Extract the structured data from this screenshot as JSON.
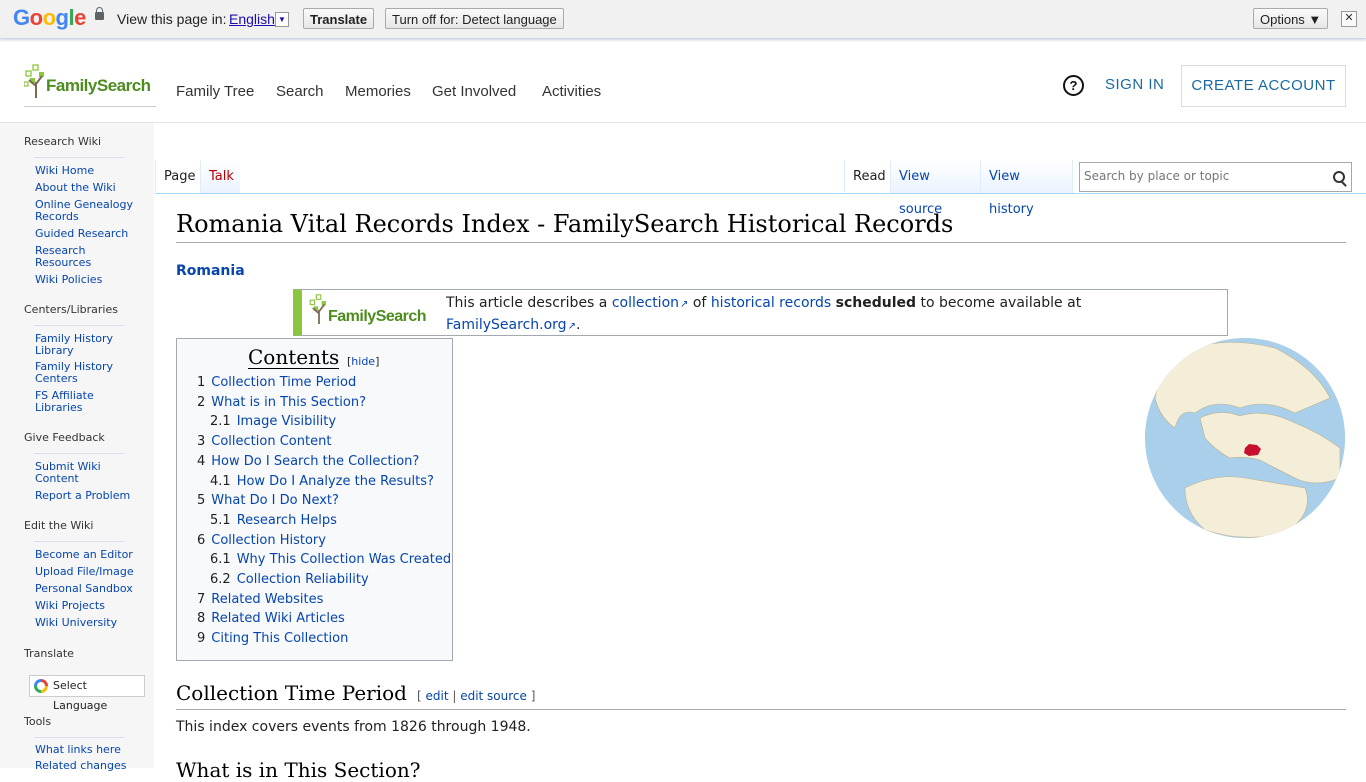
{
  "translate_bar": {
    "logo": "Google",
    "view_text": "View this page in:",
    "language": "English",
    "translate_btn": "Translate",
    "turn_off_btn": "Turn off for: Detect language",
    "options_btn": "Options ▼",
    "close": "✕"
  },
  "header": {
    "logo_text": "FamilySearch",
    "nav": [
      "Family Tree",
      "Search",
      "Memories",
      "Get Involved",
      "Activities"
    ],
    "help": "?",
    "sign_in": "SIGN IN",
    "create_account": "CREATE ACCOUNT"
  },
  "sidebar": {
    "research_wiki": "Research Wiki",
    "research_items": [
      "Wiki Home",
      "About the Wiki",
      "Online Genealogy Records",
      "Guided Research",
      "Research Resources",
      "Wiki Policies"
    ],
    "centers": "Centers/Libraries",
    "center_items": [
      "Family History Library",
      "Family History Centers",
      "FS Affiliate Libraries"
    ],
    "feedback": "Give Feedback",
    "feedback_items": [
      "Submit Wiki Content",
      "Report a Problem"
    ],
    "edit": "Edit the Wiki",
    "edit_items": [
      "Become an Editor",
      "Upload File/Image",
      "Personal Sandbox",
      "Wiki Projects",
      "Wiki University"
    ],
    "translate": "Translate",
    "select_language": "Select Language",
    "tools": "Tools",
    "tools_items": [
      "What links here",
      "Related changes"
    ]
  },
  "tabs": {
    "page": "Page",
    "talk": "Talk",
    "read": "Read",
    "view_source": "View source",
    "view_history": "View history",
    "search_placeholder": "Search by place or topic"
  },
  "article": {
    "title": "Romania Vital Records Index - FamilySearch Historical Records",
    "category": "Romania",
    "banner": {
      "logo_text": "FamilySearch",
      "t1": "This article describes a ",
      "link1": "collection",
      "t2": " of ",
      "link2": "historical records",
      "t3": " ",
      "bold": "scheduled",
      "t4": " to become available at ",
      "link3": "FamilySearch.org",
      "t5": "."
    },
    "toc": {
      "title": "Contents",
      "hide": "hide",
      "items": [
        {
          "num": "1",
          "label": "Collection Time Period",
          "level": 1
        },
        {
          "num": "2",
          "label": "What is in This Section?",
          "level": 1
        },
        {
          "num": "2.1",
          "label": "Image Visibility",
          "level": 2
        },
        {
          "num": "3",
          "label": "Collection Content",
          "level": 1
        },
        {
          "num": "4",
          "label": "How Do I Search the Collection?",
          "level": 1
        },
        {
          "num": "4.1",
          "label": "How Do I Analyze the Results?",
          "level": 2
        },
        {
          "num": "5",
          "label": "What Do I Do Next?",
          "level": 1
        },
        {
          "num": "5.1",
          "label": "Research Helps",
          "level": 2
        },
        {
          "num": "6",
          "label": "Collection History",
          "level": 1
        },
        {
          "num": "6.1",
          "label": "Why This Collection Was Created",
          "level": 2
        },
        {
          "num": "6.2",
          "label": "Collection Reliability",
          "level": 2
        },
        {
          "num": "7",
          "label": "Related Websites",
          "level": 1
        },
        {
          "num": "8",
          "label": "Related Wiki Articles",
          "level": 1
        },
        {
          "num": "9",
          "label": "Citing This Collection",
          "level": 1
        }
      ]
    },
    "section1": {
      "title": "Collection Time Period",
      "edit": "edit",
      "edit_source": "edit source",
      "text": "This index covers events from 1826 through 1948."
    },
    "section2_title": "What is in This Section?"
  },
  "colors": {
    "link": "#0645ad",
    "fs_green": "#8cc63f",
    "fs_blue": "#1a6aa1",
    "romania_red": "#c8102e"
  }
}
